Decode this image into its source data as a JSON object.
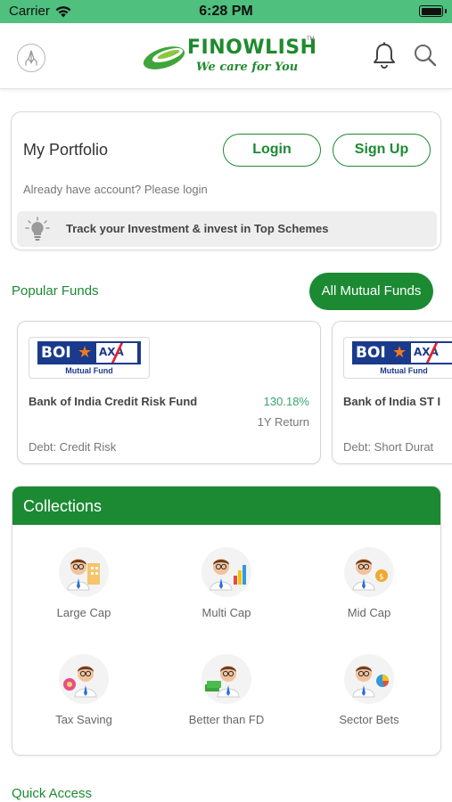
{
  "status_bar": {
    "carrier": "Carrier",
    "time": "6:28 PM"
  },
  "header": {
    "logo": {
      "name": "FINOWLISH",
      "tm": "TM",
      "tagline": "We care for You"
    },
    "brand_color": "#1c8a33"
  },
  "portfolio": {
    "title": "My Portfolio",
    "login_label": "Login",
    "signup_label": "Sign Up",
    "hint": "Already have account? Please login",
    "track_text": "Track your Investment & invest in Top Schemes"
  },
  "popular_funds": {
    "title": "Popular Funds",
    "all_button": "All Mutual Funds",
    "funds": [
      {
        "logo_boi": "BOI",
        "logo_axa": "AXA",
        "logo_sub": "Mutual Fund",
        "name": "Bank of India Credit Risk Fund",
        "return_value": "130.18%",
        "return_label": "1Y Return",
        "category": "Debt: Credit Risk"
      },
      {
        "logo_boi": "BOI",
        "logo_axa": "AXA",
        "logo_sub": "Mutual Fund",
        "name": "Bank of India ST I",
        "category": "Debt: Short Durat"
      }
    ]
  },
  "collections": {
    "title": "Collections",
    "items": [
      {
        "label": "Large Cap",
        "icon": "large-cap-icon"
      },
      {
        "label": "Multi Cap",
        "icon": "multi-cap-icon"
      },
      {
        "label": "Mid Cap",
        "icon": "mid-cap-icon"
      },
      {
        "label": "Tax Saving",
        "icon": "tax-saving-icon"
      },
      {
        "label": "Better than FD",
        "icon": "better-than-fd-icon"
      },
      {
        "label": "Sector Bets",
        "icon": "sector-bets-icon"
      }
    ]
  },
  "quick_access": {
    "title": "Quick Access"
  }
}
